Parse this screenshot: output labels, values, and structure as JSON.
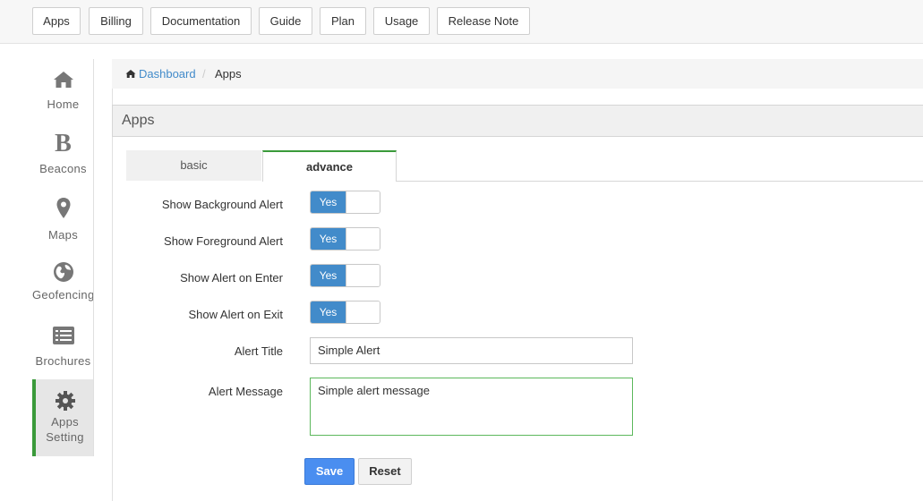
{
  "topnav": [
    "Apps",
    "Billing",
    "Documentation",
    "Guide",
    "Plan",
    "Usage",
    "Release Note"
  ],
  "sidebar": {
    "items": [
      {
        "label": "Home",
        "icon": "home-icon"
      },
      {
        "label": "Beacons",
        "icon": "beacon-b-icon"
      },
      {
        "label": "Maps",
        "icon": "map-pin-icon"
      },
      {
        "label": "Geofencing",
        "icon": "globe-icon"
      },
      {
        "label": "Brochures",
        "icon": "list-icon"
      },
      {
        "label": "Apps\nSetting",
        "label_line1": "Apps",
        "label_line2": "Setting",
        "icon": "gear-icon",
        "active": true
      }
    ]
  },
  "breadcrumb": {
    "home": "Dashboard",
    "separator": "/",
    "current": "Apps"
  },
  "panel": {
    "title": "Apps"
  },
  "tabs": {
    "basic": "basic",
    "advance": "advance",
    "active": "advance"
  },
  "form": {
    "toggles": [
      {
        "label": "Show Background Alert",
        "value": "Yes"
      },
      {
        "label": "Show Foreground Alert",
        "value": "Yes"
      },
      {
        "label": "Show Alert on Enter",
        "value": "Yes"
      },
      {
        "label": "Show Alert on Exit",
        "value": "Yes"
      }
    ],
    "alert_title_label": "Alert Title",
    "alert_title_value": "Simple Alert",
    "alert_message_label": "Alert Message",
    "alert_message_value": "Simple alert message",
    "save_label": "Save",
    "reset_label": "Reset"
  },
  "colors": {
    "accent": "#428bca",
    "active_green": "#3a9a3a",
    "save_blue": "#4a8ef0"
  }
}
